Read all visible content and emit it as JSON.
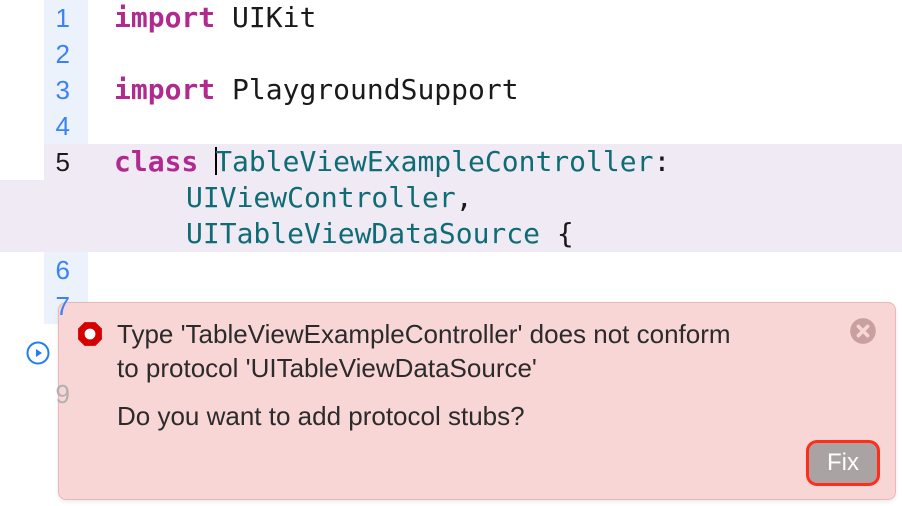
{
  "code": {
    "lines": [
      {
        "num": "1",
        "tokens": [
          {
            "cls": "kw",
            "t": "import"
          },
          {
            "cls": "plain",
            "t": " "
          },
          {
            "cls": "plain",
            "t": "UIKit"
          }
        ]
      },
      {
        "num": "2",
        "tokens": []
      },
      {
        "num": "3",
        "tokens": [
          {
            "cls": "kw",
            "t": "import"
          },
          {
            "cls": "plain",
            "t": " "
          },
          {
            "cls": "plain",
            "t": "PlaygroundSupport"
          }
        ]
      },
      {
        "num": "4",
        "tokens": []
      },
      {
        "num": "5",
        "highlight": true,
        "cursorAfter": 1,
        "tokens": [
          {
            "cls": "kw",
            "t": "class"
          },
          {
            "cls": "plain",
            "t": " "
          },
          {
            "cls": "id",
            "t": "TableViewExampleController"
          },
          {
            "cls": "plain",
            "t": ":"
          }
        ],
        "cont": [
          [
            {
              "cls": "typ",
              "t": "UIViewController"
            },
            {
              "cls": "plain",
              "t": ","
            }
          ],
          [
            {
              "cls": "typ",
              "t": "UITableViewDataSource"
            },
            {
              "cls": "plain",
              "t": " {"
            }
          ]
        ]
      },
      {
        "num": "6",
        "tokens": []
      },
      {
        "num": "7",
        "tokens": []
      },
      {
        "num": "",
        "play": true,
        "tokens": []
      },
      {
        "num": "9",
        "dim": true,
        "tokens": []
      }
    ]
  },
  "error_popup": {
    "message": "Type 'TableViewExampleController' does not conform to protocol 'UITableViewDataSource'",
    "prompt": "Do you want to add protocol stubs?",
    "fix_label": "Fix"
  },
  "icons": {
    "error_badge": "error-octagon-icon",
    "close": "close-circle-icon",
    "play": "play-circle-icon"
  }
}
